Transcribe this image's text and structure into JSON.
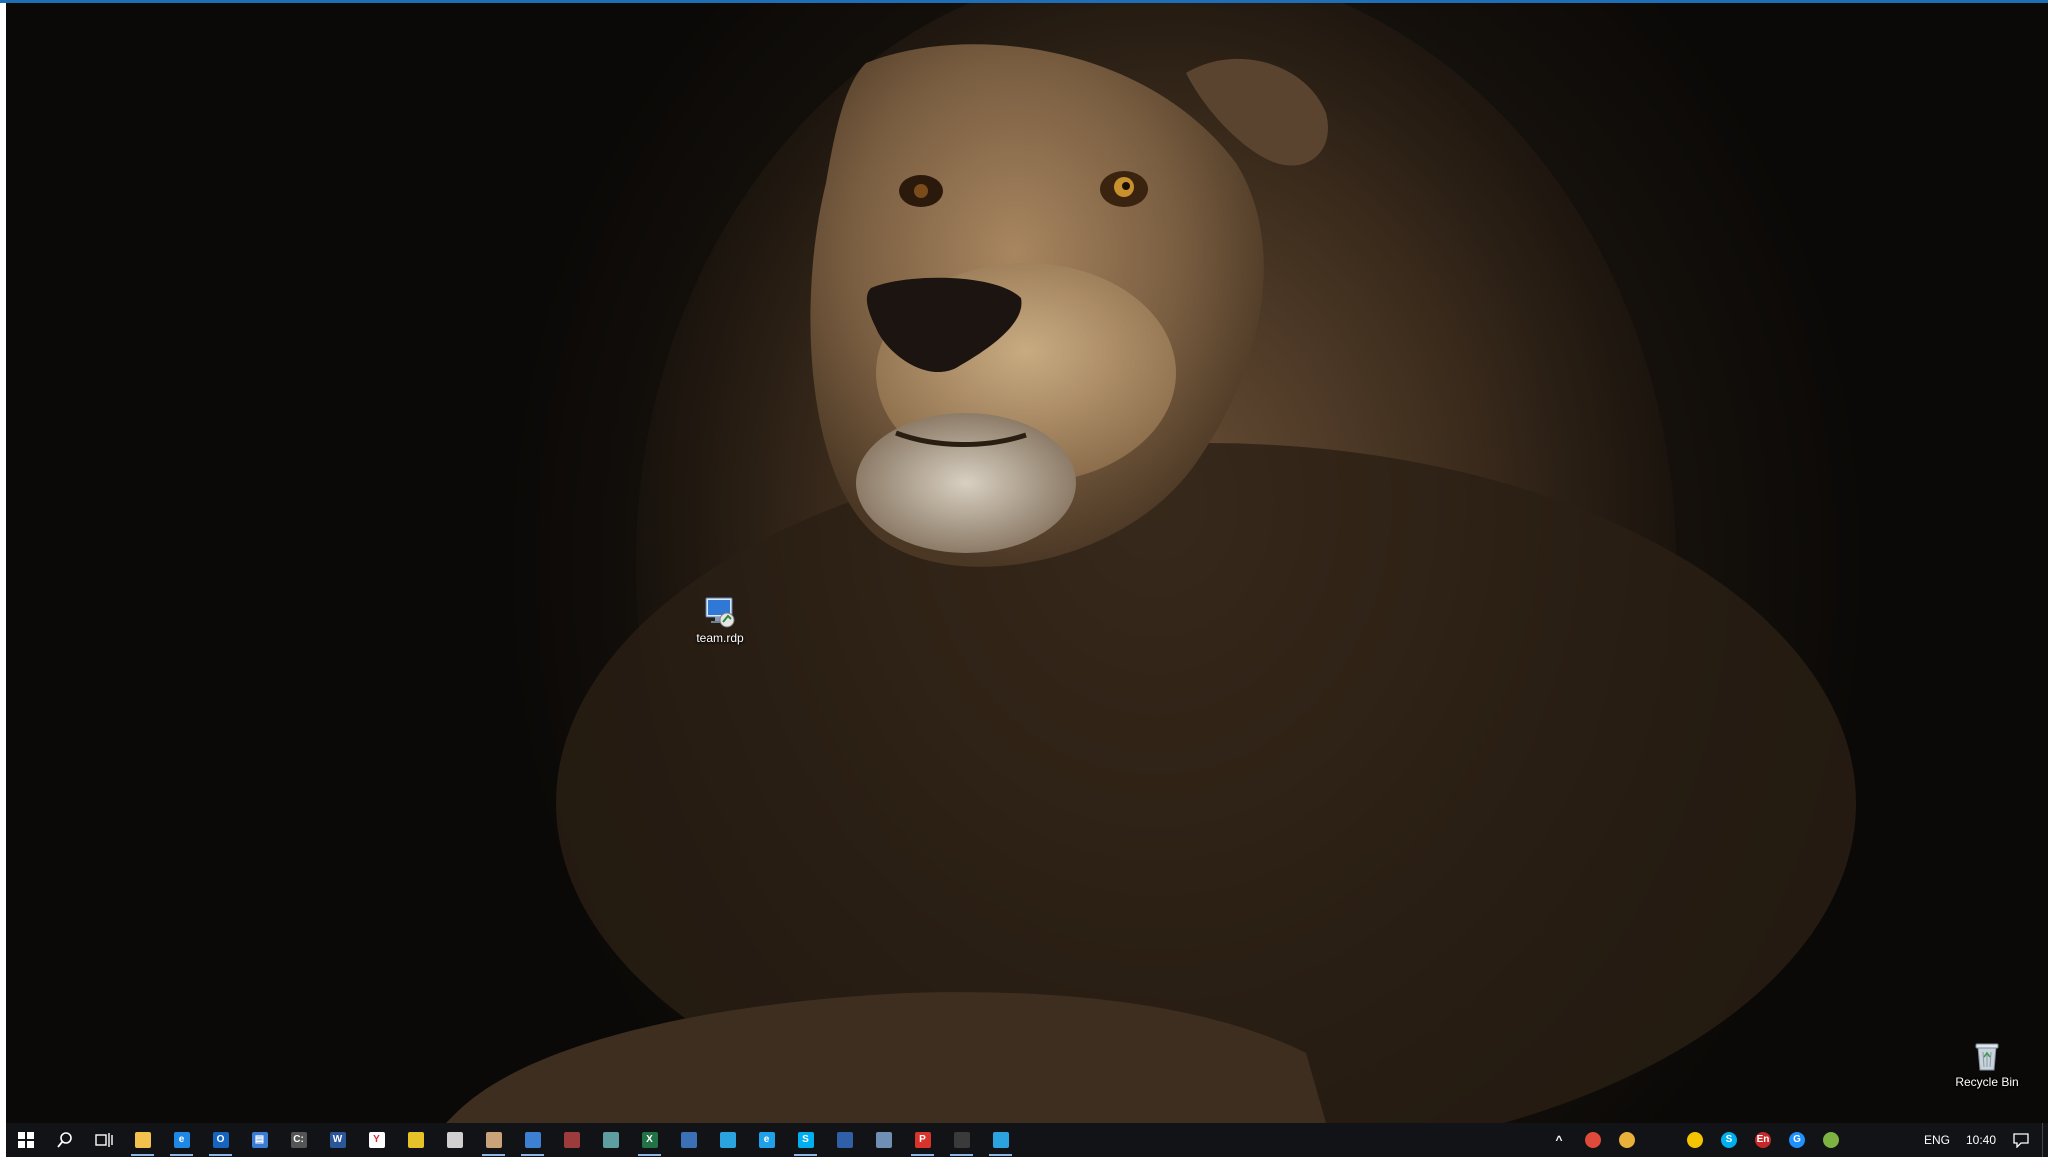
{
  "desktop": {
    "icons": [
      {
        "label": "team.rdp",
        "icon": "remote-desktop-icon"
      },
      {
        "label": "Recycle Bin",
        "icon": "recycle-bin-icon"
      }
    ]
  },
  "taskbar": {
    "apps": [
      {
        "icon": "file-explorer-icon",
        "color": "#f2c14e",
        "glyph": "",
        "running": true
      },
      {
        "icon": "edge-icon",
        "color": "#1e88e5",
        "glyph": "e",
        "running": true
      },
      {
        "icon": "outlook-icon",
        "color": "#1565c0",
        "glyph": "O",
        "running": true
      },
      {
        "icon": "contacts-icon",
        "color": "#3a7bd5",
        "glyph": "▤",
        "running": false
      },
      {
        "icon": "command-prompt-icon",
        "color": "#555555",
        "glyph": "C:",
        "running": false
      },
      {
        "icon": "word-icon",
        "color": "#2b579a",
        "glyph": "W",
        "running": false
      },
      {
        "icon": "yandex-browser-icon",
        "color": "#ffffff",
        "glyph": "Y",
        "running": false
      },
      {
        "icon": "notes-icon",
        "color": "#e6c229",
        "glyph": "",
        "running": false
      },
      {
        "icon": "calculator-icon",
        "color": "#d0d0d0",
        "glyph": "",
        "running": false
      },
      {
        "icon": "paint-icon",
        "color": "#c9a27a",
        "glyph": "",
        "running": true
      },
      {
        "icon": "remote-desktop-icon",
        "color": "#3d7fd0",
        "glyph": "",
        "running": true
      },
      {
        "icon": "archive-icon",
        "color": "#9b3b3b",
        "glyph": "",
        "running": false
      },
      {
        "icon": "control-panel-icon",
        "color": "#5f9ea0",
        "glyph": "",
        "running": false
      },
      {
        "icon": "excel-icon",
        "color": "#217346",
        "glyph": "X",
        "running": true
      },
      {
        "icon": "network-tool-icon",
        "color": "#3b6fb6",
        "glyph": "",
        "running": false
      },
      {
        "icon": "telegram-icon",
        "color": "#2aa3df",
        "glyph": "",
        "running": false
      },
      {
        "icon": "internet-explorer-icon",
        "color": "#1fa0e8",
        "glyph": "e",
        "running": false
      },
      {
        "icon": "skype-icon",
        "color": "#00aff0",
        "glyph": "S",
        "running": true
      },
      {
        "icon": "save-disk-icon",
        "color": "#2f5fa7",
        "glyph": "",
        "running": false
      },
      {
        "icon": "settings-tool-icon",
        "color": "#6f8fb5",
        "glyph": "",
        "running": false
      },
      {
        "icon": "pdf-icon",
        "color": "#d9342b",
        "glyph": "P",
        "running": true
      },
      {
        "icon": "terminal-icon",
        "color": "#3a3a3a",
        "glyph": "",
        "running": true
      },
      {
        "icon": "telegram-icon-2",
        "color": "#2aa3df",
        "glyph": "",
        "running": true
      }
    ],
    "tray": {
      "icons": [
        {
          "icon": "chevron-up-icon",
          "color": "#ffffff",
          "glyph": "^"
        },
        {
          "icon": "chrome-icon",
          "color": "#e04a3a",
          "glyph": ""
        },
        {
          "icon": "mail-tray-icon",
          "color": "#e8b23a",
          "glyph": ""
        },
        {
          "icon": "onedrive-icon",
          "color": "#ffffff",
          "glyph": ""
        },
        {
          "icon": "norton-icon",
          "color": "#f5c400",
          "glyph": ""
        },
        {
          "icon": "skype-tray-icon",
          "color": "#00aff0",
          "glyph": "S"
        },
        {
          "icon": "language-tray-icon",
          "color": "#c62828",
          "glyph": "En"
        },
        {
          "icon": "sync-icon",
          "color": "#1e90ff",
          "glyph": "G"
        },
        {
          "icon": "security-icon",
          "color": "#7cb342",
          "glyph": ""
        },
        {
          "icon": "wifi-icon",
          "color": "#ffffff",
          "glyph": ""
        },
        {
          "icon": "volume-icon",
          "color": "#ffffff",
          "glyph": ""
        }
      ],
      "language": "ENG",
      "time": "10:40",
      "notification_icon": "action-center-icon"
    }
  }
}
